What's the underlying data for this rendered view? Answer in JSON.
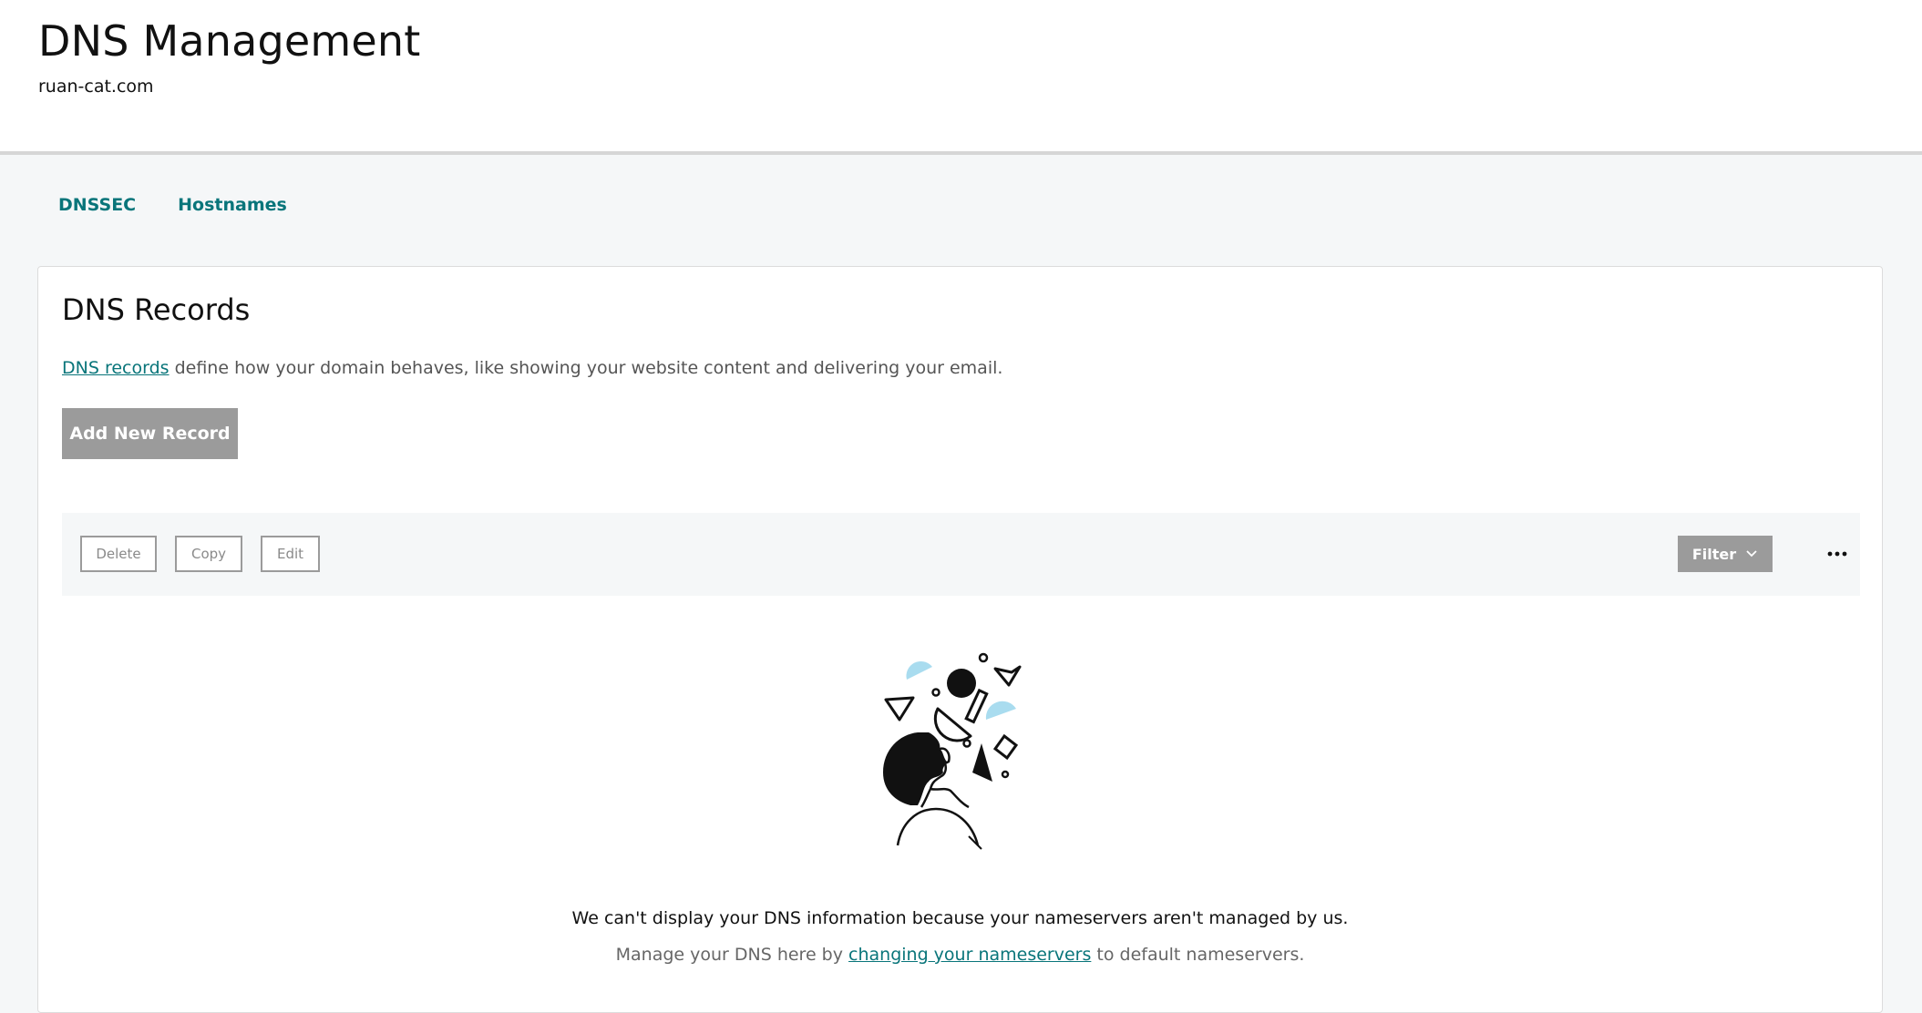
{
  "header": {
    "title": "DNS Management",
    "domain": "ruan-cat.com"
  },
  "tabs": [
    {
      "label": "DNSSEC"
    },
    {
      "label": "Hostnames"
    }
  ],
  "records": {
    "title": "DNS Records",
    "desc_link": "DNS records",
    "desc_text": " define how your domain behaves, like showing your website content and delivering your email.",
    "add_label": "Add New Record"
  },
  "toolbar": {
    "delete_label": "Delete",
    "copy_label": "Copy",
    "edit_label": "Edit",
    "filter_label": "Filter",
    "more_icon": "ellipsis-icon",
    "filter_icon": "chevron-down-icon"
  },
  "empty_state": {
    "message": "We can't display your DNS information because your nameservers aren't managed by us.",
    "sub_prefix": "Manage your DNS here by ",
    "sub_link": "changing your nameservers",
    "sub_suffix": " to default nameservers."
  },
  "colors": {
    "accent": "#09757a",
    "disabled_btn": "#9b9b9b",
    "illustration_blue": "#a9dcef"
  }
}
